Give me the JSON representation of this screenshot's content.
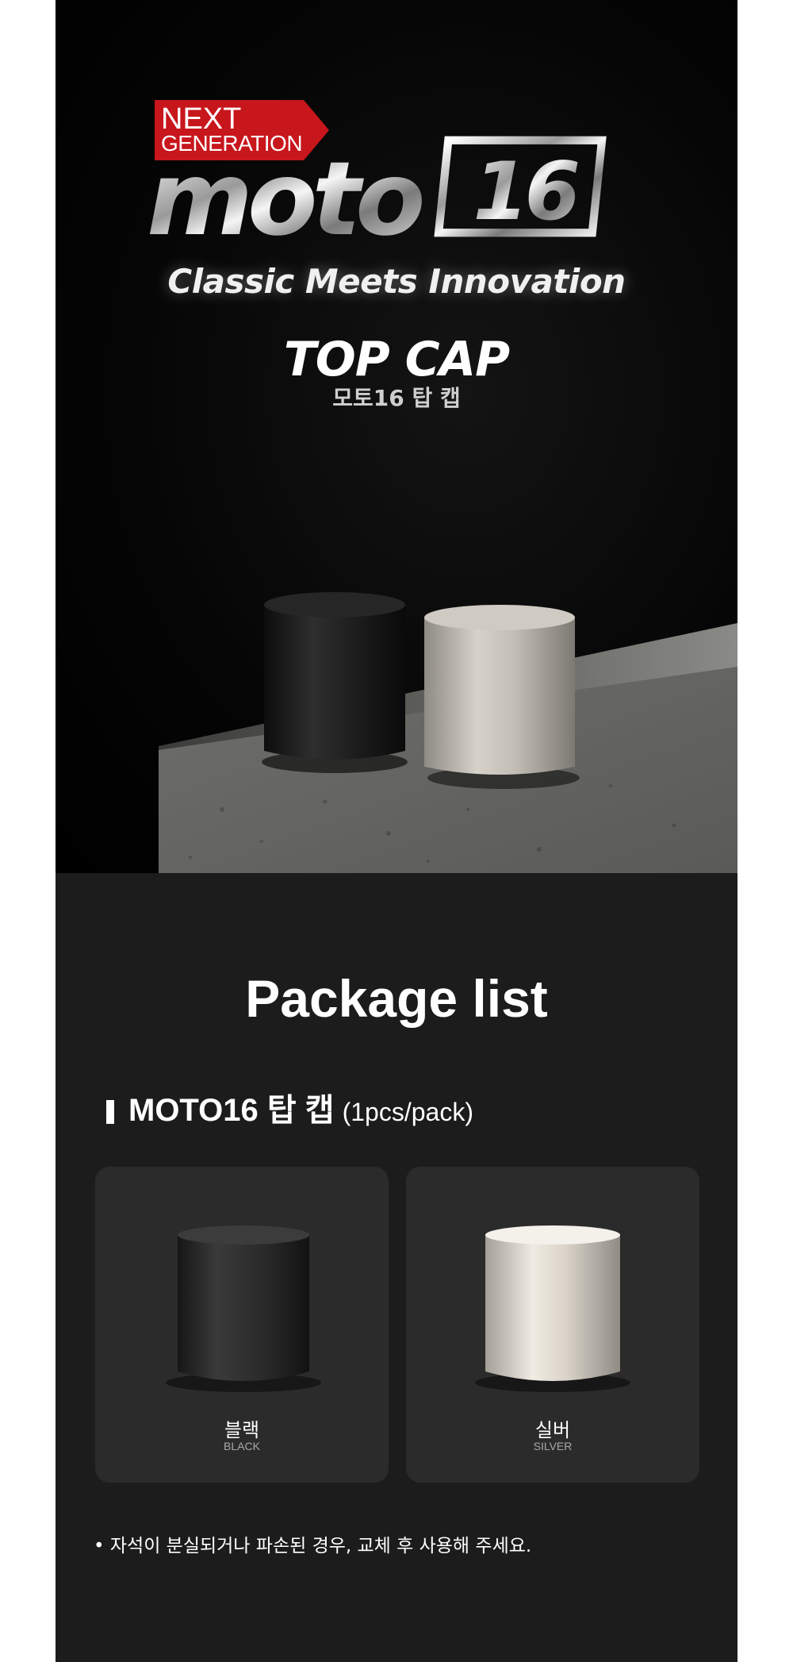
{
  "hero": {
    "badge_line1": "NEXT",
    "badge_line2": "GENERATION",
    "logo_text": "moto",
    "logo_number": "16",
    "tagline": "Classic Meets Innovation",
    "title": "TOP CAP",
    "subtitle": "모토16 탑 캡"
  },
  "package": {
    "heading": "Package list",
    "item_name": "MOTO16 탑 캡",
    "item_qty": "(1pcs/pack)",
    "variants": [
      {
        "label_ko": "블랙",
        "label_en": "BLACK",
        "color": "#2a2a2a"
      },
      {
        "label_ko": "실버",
        "label_en": "SILVER",
        "color": "#d8d2c8"
      }
    ],
    "notice": "• 자석이 분실되거나 파손된 경우, 교체 후 사용해 주세요."
  },
  "colors": {
    "brand_red": "#c8161d",
    "background": "#1c1c1c",
    "card": "#2b2b2b"
  }
}
